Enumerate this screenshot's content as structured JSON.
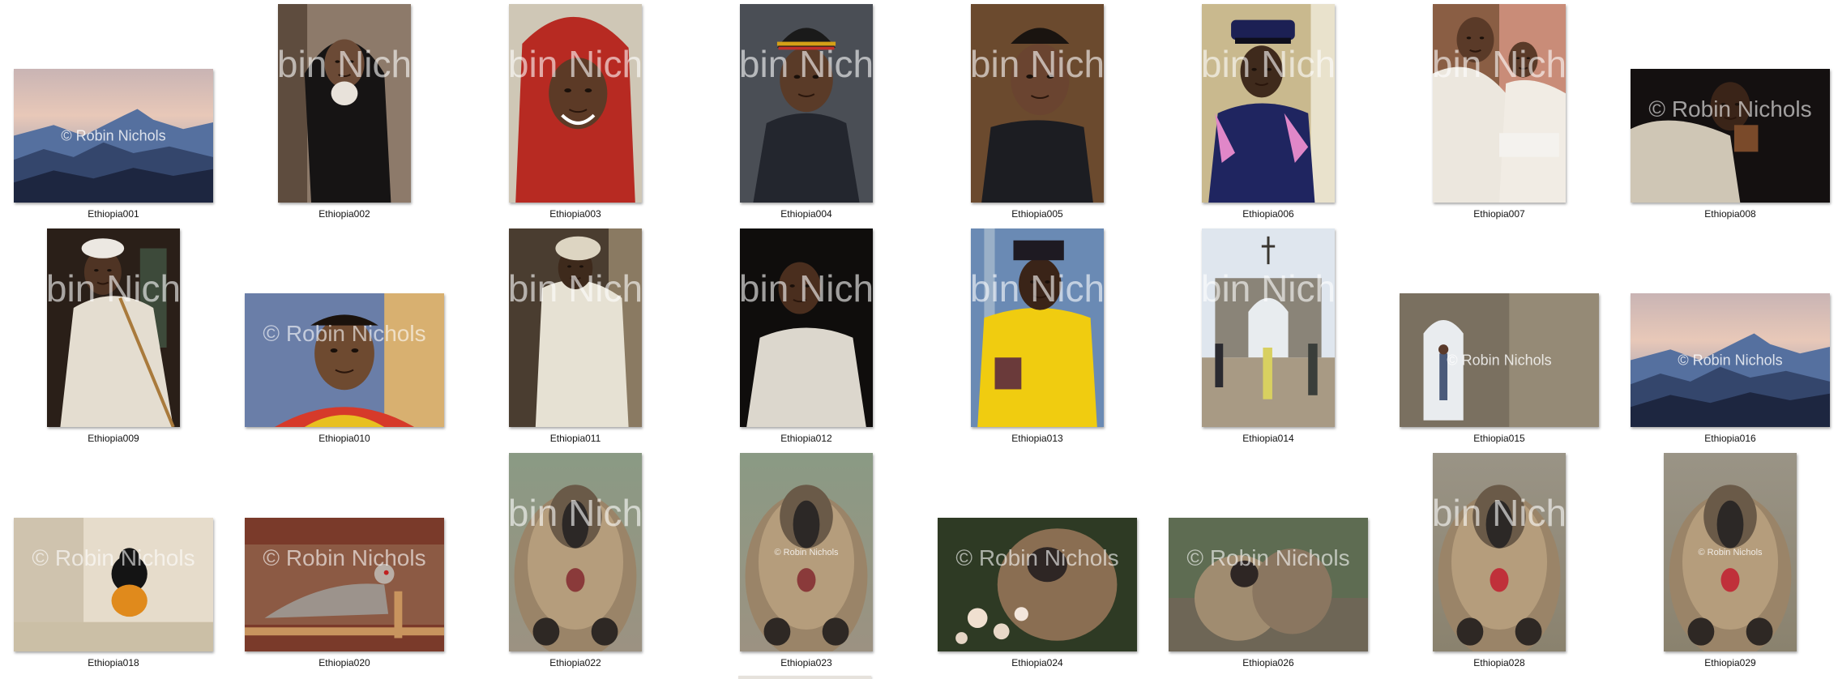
{
  "watermark": "© Robin Nichols",
  "watermark_cropped": "Robin Nichols",
  "items": [
    {
      "name": "Ethiopia001",
      "orient": "land",
      "style": "mountains",
      "wm": "small"
    },
    {
      "name": "Ethiopia002",
      "orient": "port",
      "style": "elder-black",
      "wm": "big"
    },
    {
      "name": "Ethiopia003",
      "orient": "port",
      "style": "red-hood",
      "wm": "big"
    },
    {
      "name": "Ethiopia004",
      "orient": "port",
      "style": "rasta-cap",
      "wm": "big"
    },
    {
      "name": "Ethiopia005",
      "orient": "port",
      "style": "young-man",
      "wm": "big"
    },
    {
      "name": "Ethiopia006",
      "orient": "port",
      "style": "officer",
      "wm": "big"
    },
    {
      "name": "Ethiopia007",
      "orient": "port",
      "style": "readers",
      "wm": "big"
    },
    {
      "name": "Ethiopia008",
      "orient": "land",
      "style": "reader-dark",
      "wm": "big"
    },
    {
      "name": "Ethiopia009",
      "orient": "port",
      "style": "priest-staff",
      "wm": "big"
    },
    {
      "name": "Ethiopia010",
      "orient": "land",
      "style": "boy",
      "wm": "big"
    },
    {
      "name": "Ethiopia011",
      "orient": "port",
      "style": "white-shawl",
      "wm": "big"
    },
    {
      "name": "Ethiopia012",
      "orient": "port",
      "style": "man-dark",
      "wm": "big"
    },
    {
      "name": "Ethiopia013",
      "orient": "port",
      "style": "yellow-priest",
      "wm": "big"
    },
    {
      "name": "Ethiopia014",
      "orient": "port",
      "style": "church-gate",
      "wm": "big"
    },
    {
      "name": "Ethiopia015",
      "orient": "land",
      "style": "stone-window",
      "wm": "small"
    },
    {
      "name": "Ethiopia016",
      "orient": "land",
      "style": "mountains",
      "wm": "small"
    },
    {
      "name": "Ethiopia018",
      "orient": "land",
      "style": "bird",
      "wm": "big"
    },
    {
      "name": "Ethiopia020",
      "orient": "land",
      "style": "pigeon",
      "wm": "big"
    },
    {
      "name": "Ethiopia022",
      "orient": "port",
      "style": "gelada",
      "wm": "big"
    },
    {
      "name": "Ethiopia023",
      "orient": "port",
      "style": "gelada",
      "wm": "small"
    },
    {
      "name": "Ethiopia024",
      "orient": "land",
      "style": "gelada-flowers",
      "wm": "big"
    },
    {
      "name": "Ethiopia026",
      "orient": "land",
      "style": "gelada-pair",
      "wm": "big"
    },
    {
      "name": "Ethiopia028",
      "orient": "port",
      "style": "gelada-red",
      "wm": "big"
    },
    {
      "name": "Ethiopia029",
      "orient": "port",
      "style": "gelada-red",
      "wm": "small"
    }
  ]
}
